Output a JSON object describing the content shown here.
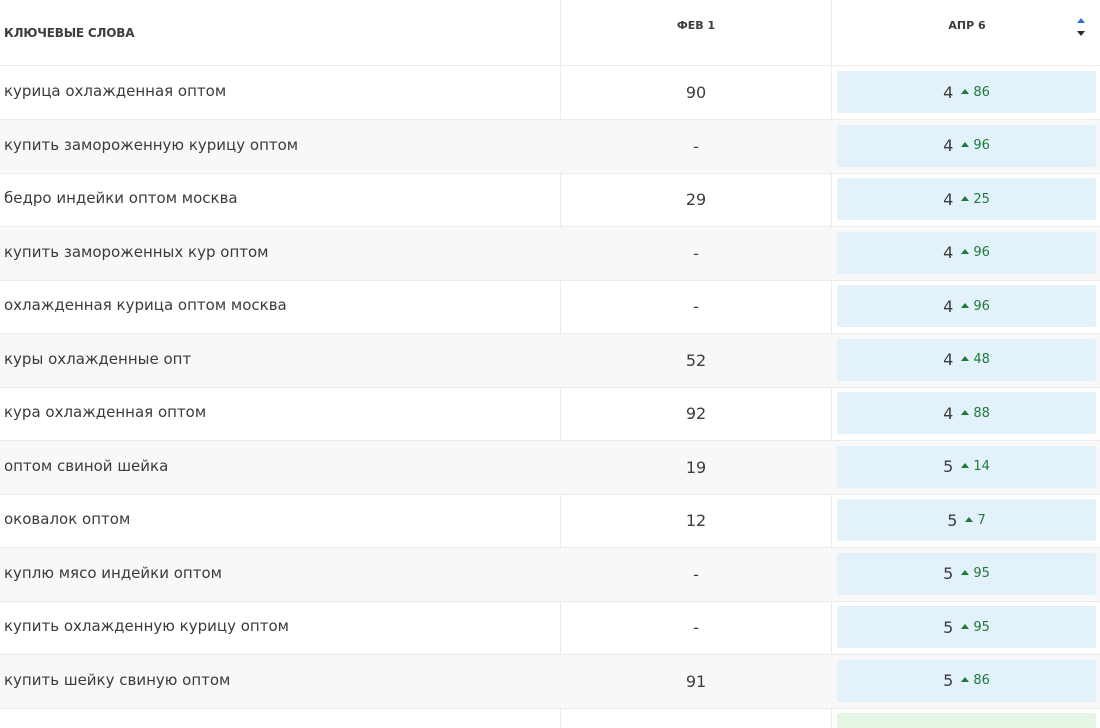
{
  "header": {
    "keywords": "КЛЮЧЕВЫЕ СЛОВА",
    "col1": "ФЕВ 1",
    "col2": "АПР 6"
  },
  "colors": {
    "cell_bg": "#e3f1fb",
    "cell_bg_last": "#e4f5e4",
    "delta_up": "#1f7a3a"
  },
  "rows": [
    {
      "keyword": "курица охлажденная оптом",
      "feb1": "90",
      "apr6": "4",
      "delta": "86"
    },
    {
      "keyword": "купить замороженную курицу оптом",
      "feb1": "-",
      "apr6": "4",
      "delta": "96"
    },
    {
      "keyword": "бедро индейки оптом москва",
      "feb1": "29",
      "apr6": "4",
      "delta": "25"
    },
    {
      "keyword": "купить замороженных кур оптом",
      "feb1": "-",
      "apr6": "4",
      "delta": "96"
    },
    {
      "keyword": "охлажденная курица оптом москва",
      "feb1": "-",
      "apr6": "4",
      "delta": "96"
    },
    {
      "keyword": "куры охлажденные опт",
      "feb1": "52",
      "apr6": "4",
      "delta": "48"
    },
    {
      "keyword": "кура охлажденная оптом",
      "feb1": "92",
      "apr6": "4",
      "delta": "88"
    },
    {
      "keyword": "оптом свиной шейка",
      "feb1": "19",
      "apr6": "5",
      "delta": "14"
    },
    {
      "keyword": "оковалок оптом",
      "feb1": "12",
      "apr6": "5",
      "delta": "7"
    },
    {
      "keyword": "куплю мясо индейки оптом",
      "feb1": "-",
      "apr6": "5",
      "delta": "95"
    },
    {
      "keyword": "купить охлажденную курицу оптом",
      "feb1": "-",
      "apr6": "5",
      "delta": "95"
    },
    {
      "keyword": "купить шейку свиную оптом",
      "feb1": "91",
      "apr6": "5",
      "delta": "86"
    }
  ]
}
